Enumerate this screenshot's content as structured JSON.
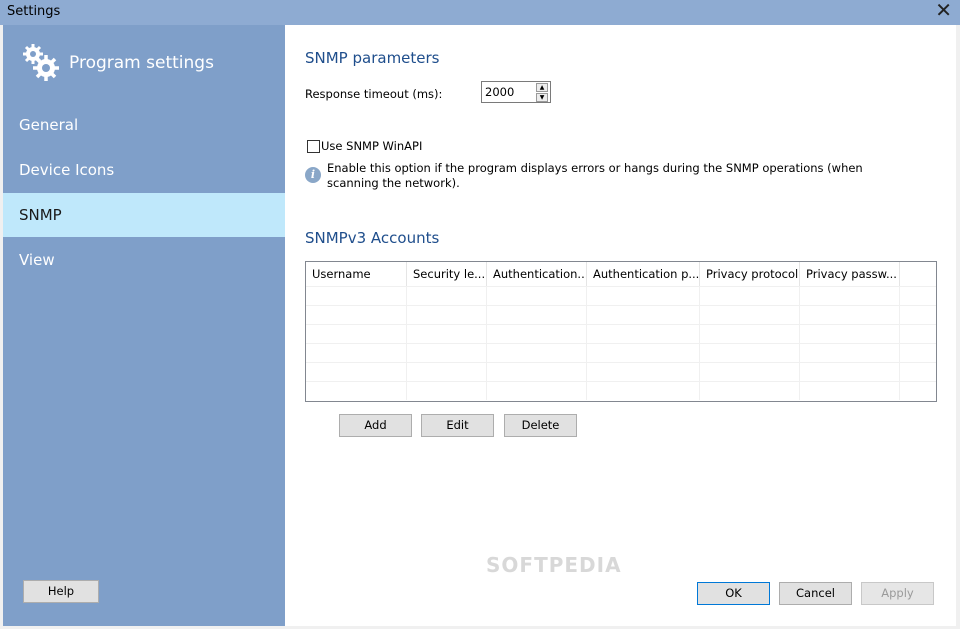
{
  "window": {
    "title": "Settings"
  },
  "sidebar": {
    "header": "Program settings",
    "items": [
      {
        "label": "General"
      },
      {
        "label": "Device Icons"
      },
      {
        "label": "SNMP"
      },
      {
        "label": "View"
      }
    ],
    "active_index": 2,
    "help_label": "Help"
  },
  "snmp": {
    "section_title": "SNMP parameters",
    "timeout_label": "Response timeout (ms):",
    "timeout_value": "2000",
    "winapi_label": "Use SNMP WinAPI",
    "winapi_checked": false,
    "info_text": "Enable this option if the program displays errors or hangs during the SNMP operations (when scanning the network)."
  },
  "accounts": {
    "section_title": "SNMPv3 Accounts",
    "columns": [
      "Username",
      "Security le...",
      "Authentication...",
      "Authentication p...",
      "Privacy protocol",
      "Privacy passw..."
    ],
    "add_label": "Add",
    "edit_label": "Edit",
    "delete_label": "Delete"
  },
  "footer": {
    "ok_label": "OK",
    "cancel_label": "Cancel",
    "apply_label": "Apply"
  },
  "watermark": "SOFTPEDIA",
  "colors": {
    "sidebar": "#7f9fc9",
    "active": "#bfe8fb",
    "titlebar": "#8eabd2",
    "heading": "#1f4e8c"
  }
}
